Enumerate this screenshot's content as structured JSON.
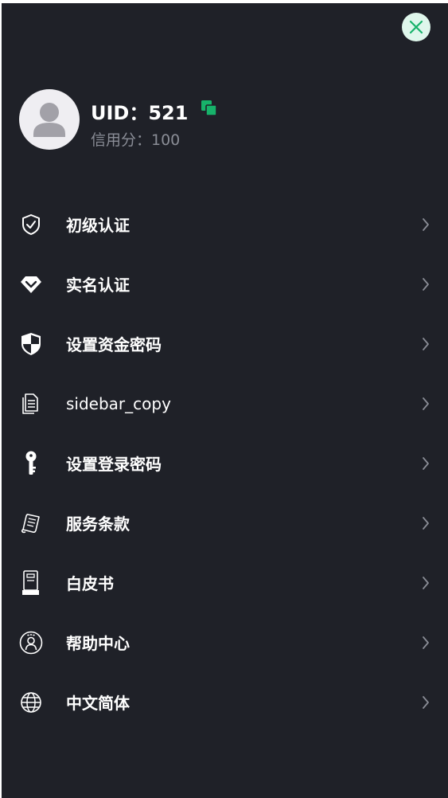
{
  "profile": {
    "uid_text": "UID：521",
    "credit_text": "信用分：100"
  },
  "colors": {
    "panel_bg": "#1f2128",
    "accent_green": "#17b26a",
    "close_bg": "#dff7ec",
    "muted_text": "#8a8d96"
  },
  "menu": {
    "items": [
      {
        "label": "初级认证",
        "icon": "shield-check-icon"
      },
      {
        "label": "实名认证",
        "icon": "diamond-check-icon"
      },
      {
        "label": "设置资金密码",
        "icon": "security-shield-icon"
      },
      {
        "label": "sidebar_copy",
        "icon": "document-copy-icon"
      },
      {
        "label": "设置登录密码",
        "icon": "key-icon"
      },
      {
        "label": "服务条款",
        "icon": "terms-scroll-icon"
      },
      {
        "label": "白皮书",
        "icon": "notebook-icon"
      },
      {
        "label": "帮助中心",
        "icon": "support-agent-icon"
      },
      {
        "label": "中文简体",
        "icon": "globe-icon"
      }
    ]
  }
}
